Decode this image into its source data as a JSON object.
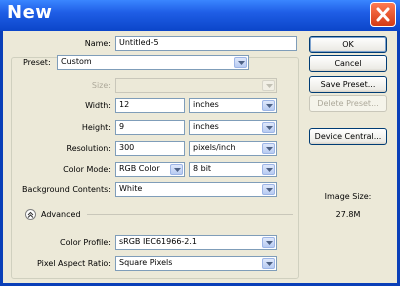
{
  "window": {
    "title": "New"
  },
  "form": {
    "name_label": "Name:",
    "name_value": "Untitled-5",
    "preset_label": "Preset:",
    "preset_value": "Custom",
    "size_label": "Size:",
    "size_value": "",
    "width_label": "Width:",
    "width_value": "12",
    "width_unit": "inches",
    "height_label": "Height:",
    "height_value": "9",
    "height_unit": "inches",
    "resolution_label": "Resolution:",
    "resolution_value": "300",
    "resolution_unit": "pixels/inch",
    "color_mode_label": "Color Mode:",
    "color_mode_value": "RGB Color",
    "bit_depth_value": "8 bit",
    "background_label": "Background Contents:",
    "background_value": "White",
    "advanced_label": "Advanced",
    "color_profile_label": "Color Profile:",
    "color_profile_value": "sRGB IEC61966-2.1",
    "pixel_aspect_label": "Pixel Aspect Ratio:",
    "pixel_aspect_value": "Square Pixels"
  },
  "buttons": {
    "ok": "OK",
    "cancel": "Cancel",
    "save_preset": "Save Preset...",
    "delete_preset": "Delete Preset...",
    "device_central": "Device Central..."
  },
  "info": {
    "image_size_label": "Image Size:",
    "image_size_value": "27.8M"
  },
  "colors": {
    "title_bar": "#0b45c9",
    "close_button": "#d33a14",
    "dialog_bg": "#ece9d8"
  }
}
